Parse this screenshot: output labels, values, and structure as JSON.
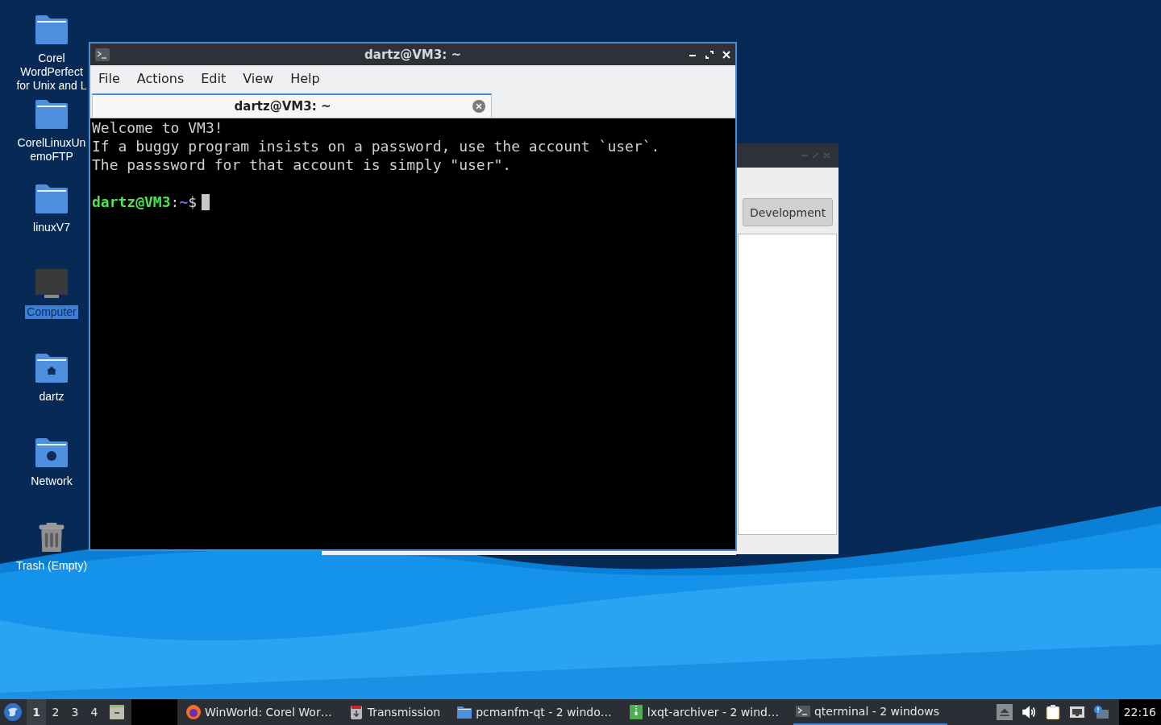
{
  "desktop_icons": [
    {
      "label": "Corel\nWordPerfect\nfor Unix and L",
      "kind": "folder",
      "selected": false
    },
    {
      "label": "CorelLinuxUn\nemoFTP",
      "kind": "folder",
      "selected": false
    },
    {
      "label": "linuxV7",
      "kind": "folder",
      "selected": false
    },
    {
      "label": "Computer",
      "kind": "computer",
      "selected": true
    },
    {
      "label": "dartz",
      "kind": "home",
      "selected": false
    },
    {
      "label": "Network",
      "kind": "network",
      "selected": false
    },
    {
      "label": "Trash (Empty)",
      "kind": "trash",
      "selected": false
    }
  ],
  "background_window": {
    "button": "Development"
  },
  "terminal": {
    "title": "dartz@VM3: ~",
    "menu": [
      "File",
      "Actions",
      "Edit",
      "View",
      "Help"
    ],
    "tabs": [
      {
        "label": "dartz@VM3: ~",
        "selected": true
      }
    ],
    "lines": [
      {
        "kind": "text",
        "text": "Welcome to VM3!"
      },
      {
        "kind": "text",
        "text": "If a buggy program insists on a password, use the account `user`."
      },
      {
        "kind": "text",
        "text": "The passsword for that account is simply \"user\"."
      },
      {
        "kind": "blank"
      },
      {
        "kind": "prompt",
        "user_host": "dartz@VM3",
        "separator": ":",
        "path": "~",
        "symbol": "$"
      }
    ]
  },
  "taskbar": {
    "desktops": [
      {
        "label": "1",
        "selected": true
      },
      {
        "label": "2",
        "selected": false
      },
      {
        "label": "3",
        "selected": false
      },
      {
        "label": "4",
        "selected": false
      }
    ],
    "tasks": [
      {
        "label": "WinWorld: Corel Wor…",
        "kind": "browser",
        "active": false
      },
      {
        "label": "Transmission",
        "kind": "transmission",
        "active": false
      },
      {
        "label": "pcmanfm-qt - 2 windo…",
        "kind": "folder",
        "active": false
      },
      {
        "label": "lxqt-archiver - 2 wind…",
        "kind": "archive",
        "active": false
      },
      {
        "label": "qterminal - 2 windows",
        "kind": "terminal",
        "active": true
      }
    ],
    "clock": "22:16"
  }
}
